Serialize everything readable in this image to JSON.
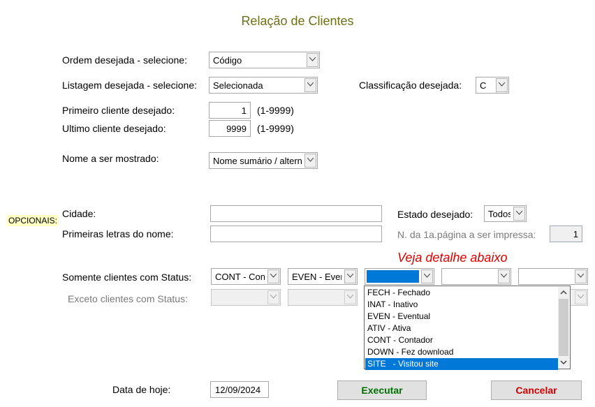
{
  "title": "Relação de Clientes",
  "ordem": {
    "label": "Ordem desejada - selecione:",
    "value": "Código"
  },
  "listagem": {
    "label": "Listagem desejada - selecione:",
    "value": "Selecionada"
  },
  "classificacao": {
    "label": "Classificação desejada:",
    "value": "C"
  },
  "primeiro": {
    "label": "Primeiro cliente desejado:",
    "value": "1",
    "range": "(1-9999)"
  },
  "ultimo": {
    "label": "Ultimo cliente desejado:",
    "value": "9999",
    "range": "(1-9999)"
  },
  "nome": {
    "label": "Nome a ser mostrado:",
    "value": "Nome sumário / alterna"
  },
  "opcionais": "OPCIONAIS:",
  "cidade": {
    "label": "Cidade:",
    "value": ""
  },
  "estado": {
    "label": "Estado desejado:",
    "value": "Todos"
  },
  "letras": {
    "label": "Primeiras letras do nome:",
    "value": ""
  },
  "pagina": {
    "label": "N. da 1a.página a ser impressa:",
    "value": "1"
  },
  "veja": "Veja detalhe abaixo",
  "somente": {
    "label": "Somente clientes com Status:",
    "values": [
      "CONT - Conta",
      "EVEN - Eventu",
      "",
      "",
      ""
    ]
  },
  "exceto": {
    "label": "Exceto  clientes com Status:"
  },
  "dropdown": {
    "items": [
      "FECH - Fechado",
      "INAT - Inativo",
      "EVEN - Eventual",
      "ATIV - Ativa",
      "CONT - Contador",
      "DOWN - Fez download",
      "SITE   - Visitou site"
    ],
    "selected_index": 6
  },
  "data": {
    "label": "Data de hoje:",
    "value": "12/09/2024"
  },
  "buttons": {
    "executar": "Executar",
    "cancelar": "Cancelar"
  },
  "colors": {
    "title": "#6f6f1a",
    "veja": "#e00000",
    "executar": "#007000",
    "cancelar": "#d00000",
    "selection": "#0078d7"
  }
}
